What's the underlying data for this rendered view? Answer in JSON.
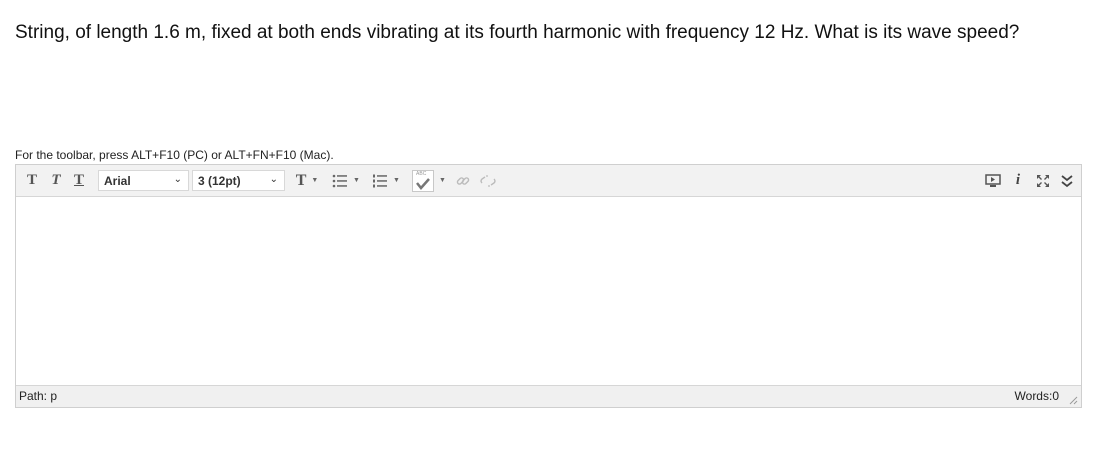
{
  "question": {
    "text": "String, of length 1.6 m, fixed at both ends vibrating at its fourth harmonic with frequency 12 Hz.  What is its wave speed?"
  },
  "editor": {
    "toolbar_hint": "For the toolbar, press ALT+F10 (PC) or ALT+FN+F10 (Mac).",
    "toolbar": {
      "bold_label": "T",
      "italic_label": "T",
      "underline_label": "T",
      "font_family": "Arial",
      "font_size": "3 (12pt)",
      "text_color_label": "T",
      "spellcheck_label": "ABC",
      "info_label": "i",
      "icons": [
        "format-text-icon",
        "bullet-list-icon",
        "numbered-list-icon",
        "spellcheck-icon",
        "link-icon",
        "unlink-icon",
        "preview-icon",
        "info-icon",
        "fullscreen-icon",
        "expand-toolbar-icon"
      ]
    },
    "statusbar": {
      "path_label": "Path: p",
      "words_label": "Words:0"
    }
  }
}
